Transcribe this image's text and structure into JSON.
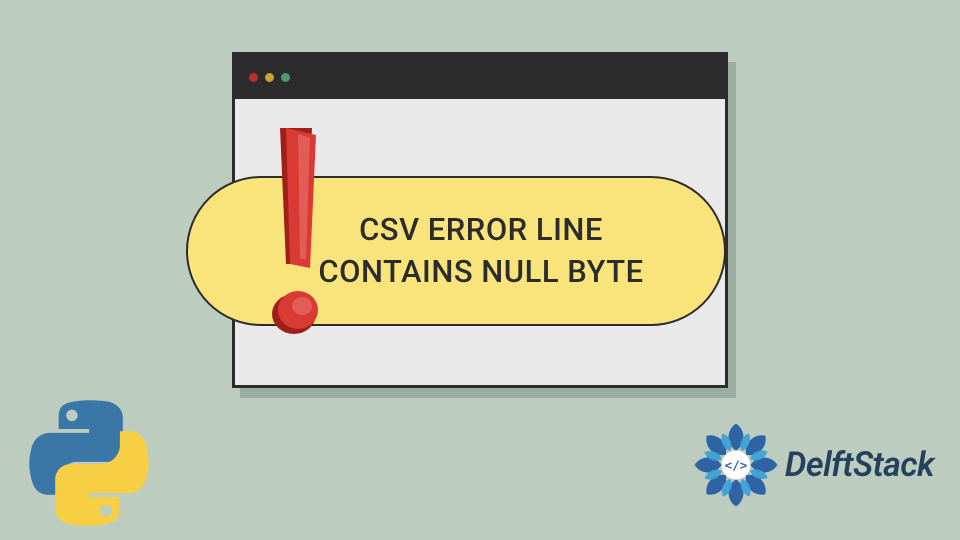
{
  "error": {
    "line1": "CSV ERROR LINE",
    "line2": "CONTAINS NULL BYTE"
  },
  "brand": {
    "name": "DelftStack"
  },
  "colors": {
    "bg": "#bccdbf",
    "window_bg": "#e9e9e9",
    "window_border": "#2c2c2c",
    "titlebar": "#2c2c2c",
    "pill": "#f8e47a",
    "excl": "#d22e27",
    "brand_text": "#25415e",
    "py_blue": "#3a76a6",
    "py_yellow": "#f7cf45"
  },
  "icons": {
    "traffic_red": "close-dot",
    "traffic_yellow": "minimize-dot",
    "traffic_green": "zoom-dot",
    "exclamation": "exclamation-icon",
    "python": "python-logo",
    "delftstack_mark": "delftstack-mark"
  }
}
